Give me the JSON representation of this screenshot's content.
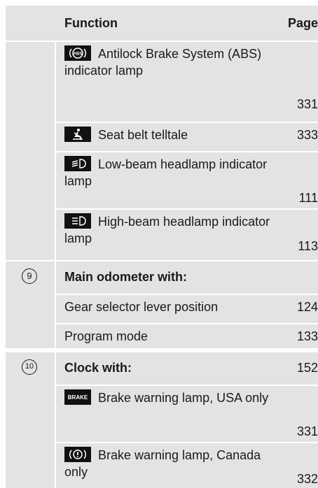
{
  "header": {
    "function_label": "Function",
    "page_label": "Page"
  },
  "rows": [
    {
      "icon": "abs-icon",
      "text": "Antilock Brake System (ABS) indicator lamp",
      "page": "331"
    },
    {
      "icon": "seat-belt-icon",
      "text": "Seat belt telltale",
      "page": "333"
    },
    {
      "icon": "low-beam-icon",
      "text": "Low-beam headlamp indicator lamp",
      "page": "111"
    },
    {
      "icon": "high-beam-icon",
      "text": "High-beam headlamp indicator lamp",
      "page": "113"
    }
  ],
  "section9": {
    "number": "9",
    "title": "Main odometer with:",
    "items": [
      {
        "text": "Gear selector lever position",
        "page": "124"
      },
      {
        "text": "Program mode",
        "page": "133"
      }
    ]
  },
  "section10": {
    "number": "10",
    "title": "Clock with:",
    "page": "152",
    "items": [
      {
        "icon": "brake-text-icon",
        "icon_text": "BRAKE",
        "text": "Brake warning lamp, USA only",
        "page": "331"
      },
      {
        "icon": "brake-circle-icon",
        "text": "Brake warning lamp, Canada only",
        "page": "332"
      }
    ]
  }
}
